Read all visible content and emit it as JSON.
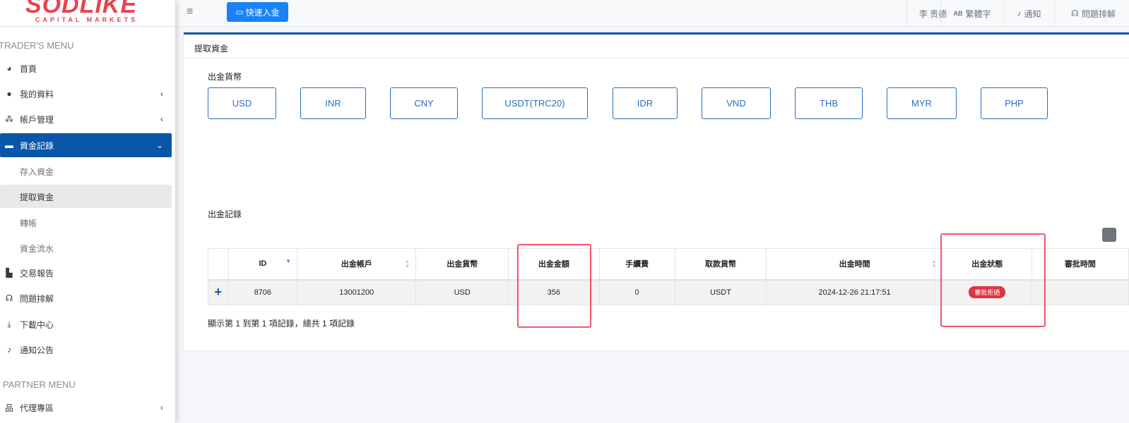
{
  "logo": {
    "name": "SODLIKE",
    "tagline": "CAPITAL MARKETS"
  },
  "sidebar": {
    "trader_heading": "TRADER'S MENU",
    "items": [
      {
        "label": "首頁",
        "icon": "dashboard-icon"
      },
      {
        "label": "我的資料",
        "icon": "user-icon"
      },
      {
        "label": "帳戶管理",
        "icon": "users-icon"
      },
      {
        "label": "資金記錄",
        "icon": "credit-card-icon"
      },
      {
        "label": "交易報告",
        "icon": "chart-icon"
      },
      {
        "label": "問題排解",
        "icon": "headset-icon"
      },
      {
        "label": "下載中心",
        "icon": "download-icon"
      },
      {
        "label": "通知公告",
        "icon": "bell-icon"
      }
    ],
    "subitems": [
      "存入資金",
      "提取資金",
      "轉帳",
      "資金流水"
    ],
    "partner_heading": "PARTNER MENU",
    "partner_items": [
      {
        "label": "代理專區",
        "icon": "sitemap-icon"
      }
    ]
  },
  "header": {
    "quick_deposit": "快速入金",
    "user": "李 贵德",
    "language": "繁體字",
    "notify": "通知",
    "support": "問題排解"
  },
  "card": {
    "title": "提取資金",
    "currency_label": "出金貨幣",
    "records_label": "出金記錄",
    "currencies": [
      "USD",
      "INR",
      "CNY",
      "USDT(TRC20)",
      "IDR",
      "VND",
      "THB",
      "MYR",
      "PHP"
    ]
  },
  "table": {
    "headers": [
      "ID",
      "出金帳戶",
      "出金貨幣",
      "出金金額",
      "手續費",
      "取款貨幣",
      "出金時間",
      "出金狀態",
      "審批時間"
    ],
    "rows": [
      {
        "id": "8706",
        "account": "13001200",
        "currency": "USD",
        "amount": "356",
        "fee": "0",
        "withdraw_currency": "USDT",
        "time": "2024-12-26 21:17:51",
        "status": "審批拒絕",
        "approve_time": ""
      }
    ],
    "footer": "顯示第 1 到第 1 項記錄，總共 1 項記錄"
  },
  "colors": {
    "primary": "#0b56a8",
    "button": "#1a82f7",
    "danger": "#dc3545",
    "annotation": "#f2566a"
  }
}
